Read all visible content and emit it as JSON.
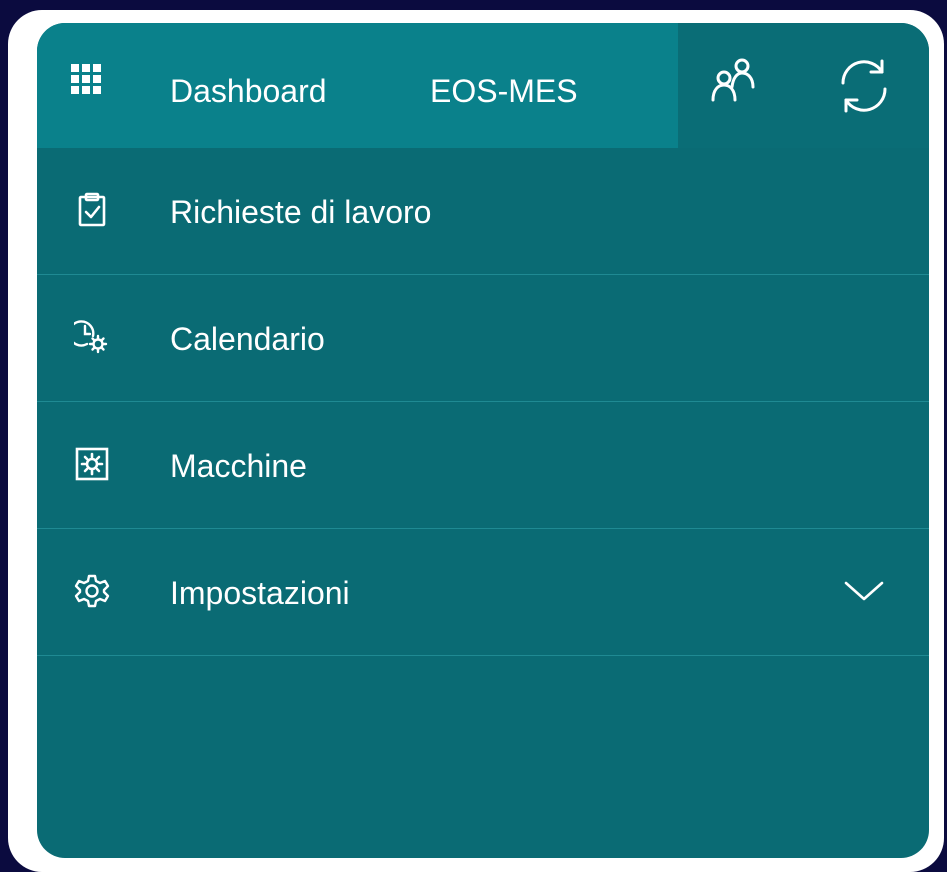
{
  "header": {
    "app_launcher_icon": "waffle-icon",
    "dashboard_label": "Dashboard",
    "app_name": "EOS-MES",
    "people_icon": "people-icon",
    "sync_icon": "sync-icon"
  },
  "menu": {
    "items": [
      {
        "label": "Richieste di lavoro",
        "icon": "clipboard-check-icon"
      },
      {
        "label": "Calendario",
        "icon": "clock-gear-icon"
      },
      {
        "label": "Macchine",
        "icon": "machine-gear-icon"
      },
      {
        "label": "Impostazioni",
        "icon": "gear-icon",
        "expandable": true,
        "expand_icon": "chevron-down-icon"
      }
    ]
  },
  "colors": {
    "background": "#0b0b3f",
    "frame": "#ffffff",
    "panel": "#0a6b74",
    "header_main": "#0a818b",
    "header_right": "#0a6d76",
    "divider": "#1f8a93",
    "text": "#ffffff"
  }
}
